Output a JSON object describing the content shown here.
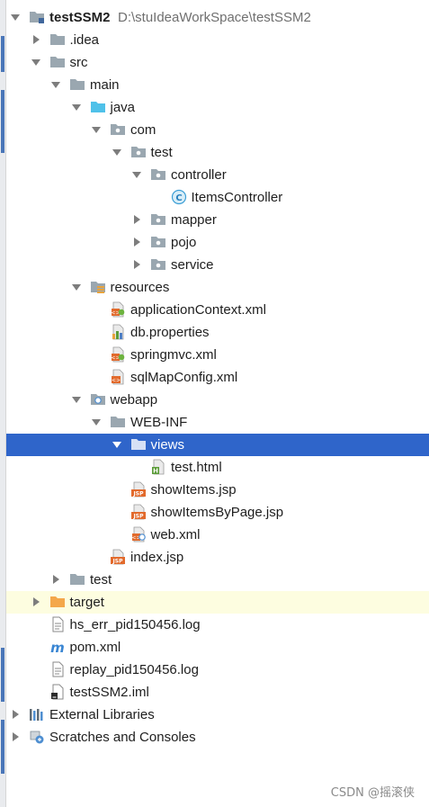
{
  "tree": [
    {
      "depth": 0,
      "state": "open",
      "icon": "module-folder-icon",
      "label": "testSSM2",
      "bold": true,
      "path": "D:\\stuIdeaWorkSpace\\testSSM2"
    },
    {
      "depth": 1,
      "state": "closed",
      "icon": "folder-icon",
      "label": ".idea"
    },
    {
      "depth": 1,
      "state": "open",
      "icon": "folder-icon",
      "label": "src"
    },
    {
      "depth": 2,
      "state": "open",
      "icon": "folder-icon",
      "label": "main"
    },
    {
      "depth": 3,
      "state": "open",
      "icon": "source-folder-icon",
      "label": "java"
    },
    {
      "depth": 4,
      "state": "open",
      "icon": "package-icon",
      "label": "com"
    },
    {
      "depth": 5,
      "state": "open",
      "icon": "package-icon",
      "label": "test"
    },
    {
      "depth": 6,
      "state": "open",
      "icon": "package-icon",
      "label": "controller"
    },
    {
      "depth": 7,
      "state": "leaf",
      "icon": "class-icon",
      "label": "ItemsController"
    },
    {
      "depth": 6,
      "state": "closed",
      "icon": "package-icon",
      "label": "mapper"
    },
    {
      "depth": 6,
      "state": "closed",
      "icon": "package-icon",
      "label": "pojo"
    },
    {
      "depth": 6,
      "state": "closed",
      "icon": "package-icon",
      "label": "service"
    },
    {
      "depth": 3,
      "state": "open",
      "icon": "resources-folder-icon",
      "label": "resources"
    },
    {
      "depth": 4,
      "state": "leaf",
      "icon": "spring-xml-icon",
      "label": "applicationContext.xml"
    },
    {
      "depth": 4,
      "state": "leaf",
      "icon": "properties-icon",
      "label": "db.properties"
    },
    {
      "depth": 4,
      "state": "leaf",
      "icon": "spring-xml-icon",
      "label": "springmvc.xml"
    },
    {
      "depth": 4,
      "state": "leaf",
      "icon": "xml-icon",
      "label": "sqlMapConfig.xml"
    },
    {
      "depth": 3,
      "state": "open",
      "icon": "web-folder-icon",
      "label": "webapp"
    },
    {
      "depth": 4,
      "state": "open",
      "icon": "folder-icon",
      "label": "WEB-INF"
    },
    {
      "depth": 5,
      "state": "open",
      "icon": "folder-icon",
      "label": "views",
      "selected": true
    },
    {
      "depth": 6,
      "state": "leaf",
      "icon": "html-file-icon",
      "label": "test.html"
    },
    {
      "depth": 5,
      "state": "leaf",
      "icon": "jsp-file-icon",
      "label": "showItems.jsp"
    },
    {
      "depth": 5,
      "state": "leaf",
      "icon": "jsp-file-icon",
      "label": "showItemsByPage.jsp"
    },
    {
      "depth": 5,
      "state": "leaf",
      "icon": "web-xml-icon",
      "label": "web.xml"
    },
    {
      "depth": 4,
      "state": "leaf",
      "icon": "jsp-file-icon",
      "label": "index.jsp"
    },
    {
      "depth": 2,
      "state": "closed",
      "icon": "folder-icon",
      "label": "test"
    },
    {
      "depth": 1,
      "state": "closed",
      "icon": "excluded-folder-icon",
      "label": "target",
      "highlight": true
    },
    {
      "depth": 1,
      "state": "leaf",
      "icon": "text-file-icon",
      "label": "hs_err_pid150456.log"
    },
    {
      "depth": 1,
      "state": "leaf",
      "icon": "maven-icon",
      "label": "pom.xml"
    },
    {
      "depth": 1,
      "state": "leaf",
      "icon": "text-file-icon",
      "label": "replay_pid150456.log"
    },
    {
      "depth": 1,
      "state": "leaf",
      "icon": "iml-file-icon",
      "label": "testSSM2.iml"
    },
    {
      "depth": 0,
      "state": "closed",
      "icon": "libraries-icon",
      "label": "External Libraries"
    },
    {
      "depth": 0,
      "state": "closed",
      "icon": "scratches-icon",
      "label": "Scratches and Consoles"
    }
  ],
  "watermark": "CSDN @摇滚侠"
}
